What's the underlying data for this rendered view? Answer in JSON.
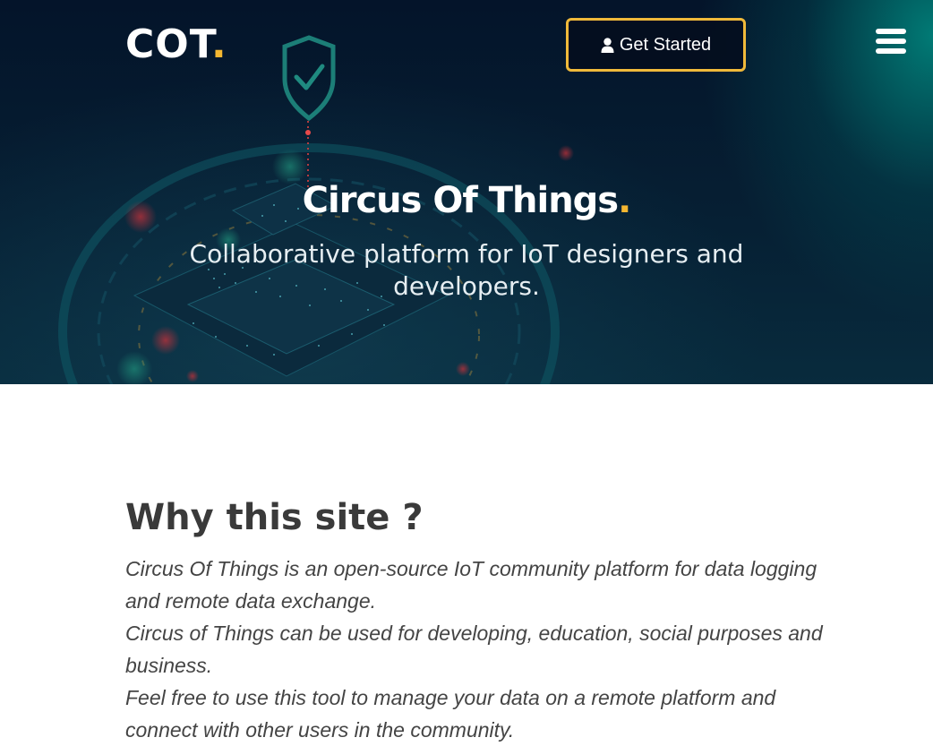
{
  "header": {
    "brand_text": "COT",
    "brand_dot": ".",
    "cta_label": "Get Started",
    "cta_icon": "user-icon",
    "menu_icon": "hamburger-menu-icon"
  },
  "hero": {
    "title_text": "Circus Of Things",
    "title_dot": ".",
    "subtitle": "Collaborative platform for IoT designers and developers."
  },
  "about": {
    "heading": "Why this site ?",
    "paragraphs": [
      "Circus Of Things is an open-source IoT community platform for data logging and remote data exchange.",
      "Circus of Things can be used for developing, education, social purposes and business.",
      "Feel free to use this tool to manage your data on a remote platform and connect with other users in the community."
    ]
  },
  "colors": {
    "accent": "#f5b731",
    "hero_bg": "#061f33",
    "text_dark": "#3a3a3a",
    "text_body": "#444444"
  }
}
